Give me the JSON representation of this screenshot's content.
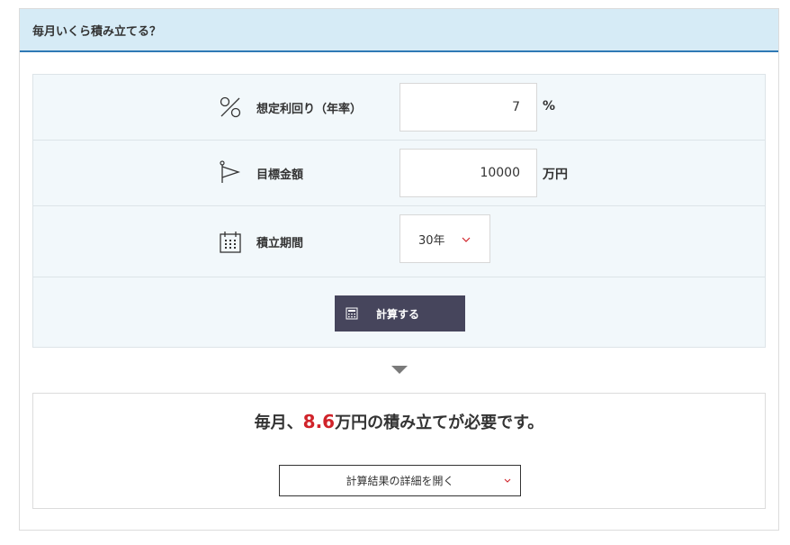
{
  "header": {
    "title": "毎月いくら積み立てる？"
  },
  "form": {
    "rate": {
      "label": "想定利回り（年率）",
      "value": "7",
      "unit": "%",
      "icon": "percent-icon"
    },
    "target": {
      "label": "目標金額",
      "value": "10000",
      "unit": "万円",
      "icon": "flag-icon"
    },
    "period": {
      "label": "積立期間",
      "value": "30年",
      "icon": "calendar-icon"
    },
    "calc_button": {
      "label": "計算する",
      "icon": "calculator-icon"
    }
  },
  "result": {
    "prefix": "毎月、",
    "value": "8.6",
    "suffix": "万円の積み立てが必要です。",
    "detail_button": "計算結果の詳細を開く"
  },
  "colors": {
    "header_bg": "#d6ebf6",
    "header_border": "#2f79b5",
    "form_bg": "#f2f8fb",
    "button_bg": "#46455c",
    "accent_red": "#d0232a"
  }
}
